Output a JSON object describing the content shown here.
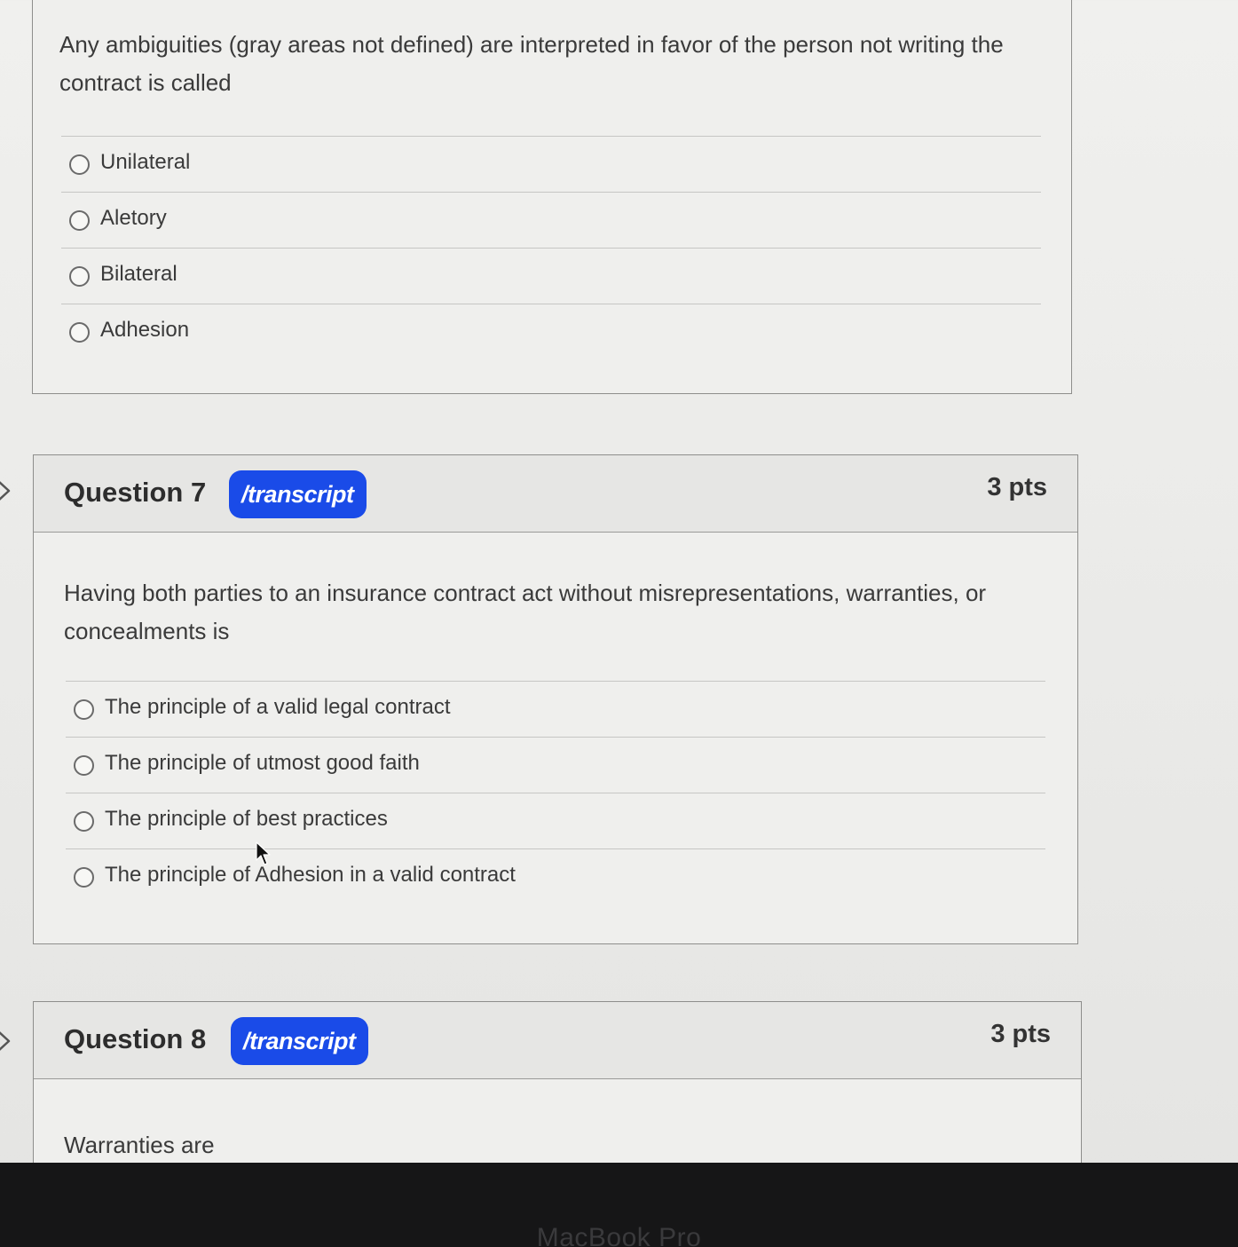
{
  "q6": {
    "text": "Any ambiguities (gray areas not defined) are interpreted in favor of the person not writing the contract is called",
    "answers": [
      "Unilateral",
      "Aletory",
      "Bilateral",
      "Adhesion"
    ]
  },
  "q7": {
    "title": "Question 7",
    "badge": "/transcript",
    "points": "3 pts",
    "text": "Having both parties to an insurance contract act without misrepresentations, warranties, or concealments is",
    "answers": [
      "The principle of a valid legal contract",
      "The principle of utmost good faith",
      "The principle of best practices",
      "The principle of Adhesion in a valid contract"
    ]
  },
  "q8": {
    "title": "Question 8",
    "badge": "/transcript",
    "points": "3 pts",
    "text": "Warranties are"
  },
  "bezel": {
    "label": "MacBook Pro"
  },
  "colors": {
    "badge": "#1a4be8",
    "card_border": "#8e8e8c",
    "header_bg": "#e6e6e4"
  }
}
